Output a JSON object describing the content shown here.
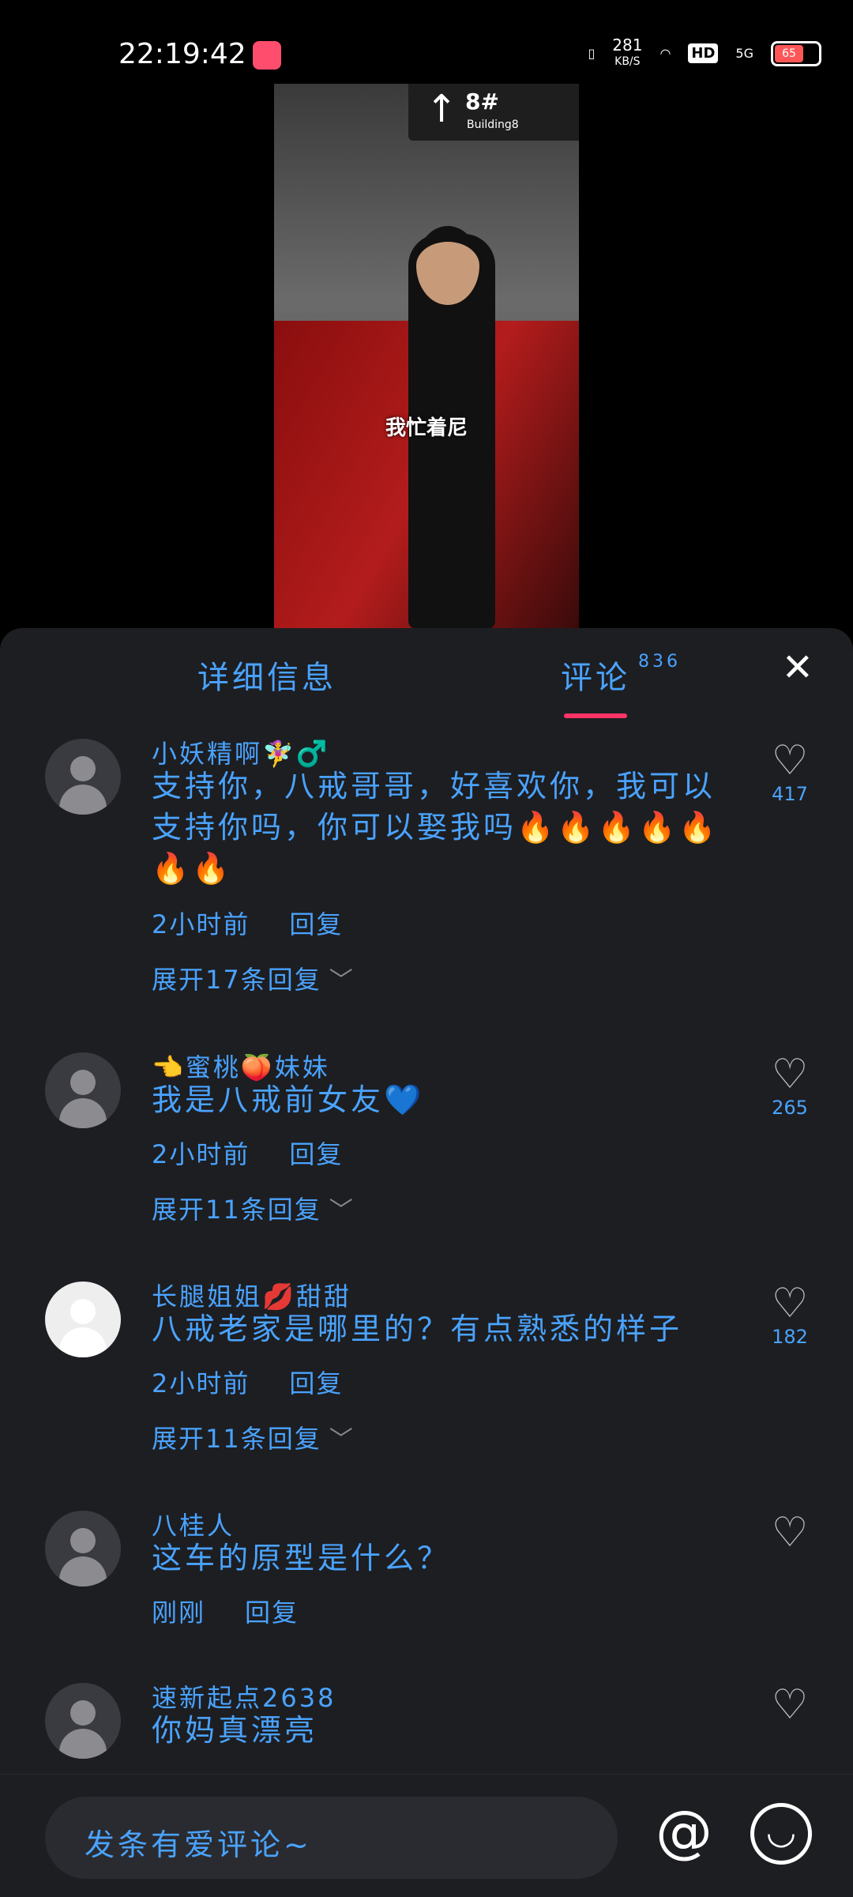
{
  "status_bar": {
    "time": "22:19:42",
    "speed_top": "281",
    "speed_bottom": "KB/S",
    "hd": "HD",
    "network": "5G",
    "battery": "65"
  },
  "video": {
    "sign_arrow": "↑",
    "sign_number": "8#",
    "sign_building": "Building8",
    "caption": "我忙着尼"
  },
  "tabs": {
    "details": "详细信息",
    "comments": "评论",
    "comments_count": "836",
    "close": "✕"
  },
  "comments": [
    {
      "name": "小妖精啊🧚‍♀️♂️",
      "text": "支持你，八戒哥哥，好喜欢你，我可以支持你吗，你可以娶我吗🔥🔥🔥🔥🔥🔥🔥",
      "time": "2小时前",
      "reply": "回复",
      "expand": "展开17条回复",
      "likes": "417"
    },
    {
      "name": "👈蜜桃🍑妹妹",
      "text": "我是八戒前女友💙",
      "time": "2小时前",
      "reply": "回复",
      "expand": "展开11条回复",
      "likes": "265"
    },
    {
      "name": "长腿姐姐💋甜甜",
      "text": "八戒老家是哪里的？有点熟悉的样子",
      "time": "2小时前",
      "reply": "回复",
      "expand": "展开11条回复",
      "likes": "182"
    },
    {
      "name": "八桂人",
      "text": "这车的原型是什么？",
      "time": "刚刚",
      "reply": "回复",
      "likes": ""
    },
    {
      "name": "速新起点2638",
      "text": "你妈真漂亮",
      "likes": ""
    }
  ],
  "input": {
    "placeholder": "发条有爱评论~",
    "at": "@"
  }
}
